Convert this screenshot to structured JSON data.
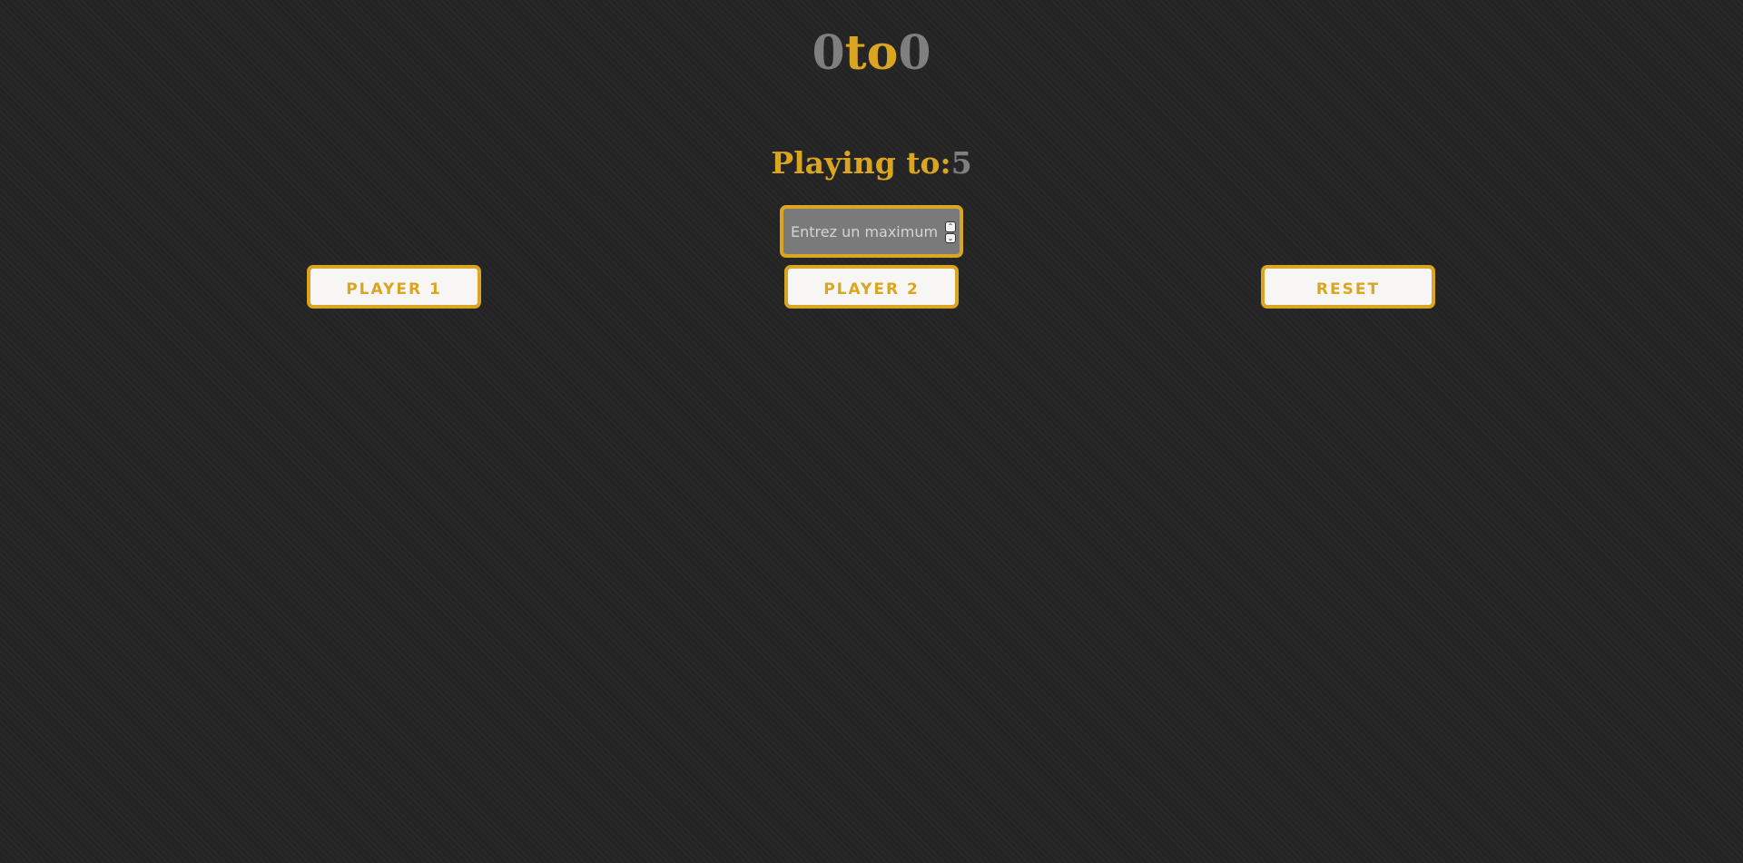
{
  "scoreboard": {
    "player1_score": "0",
    "separator": "to",
    "player2_score": "0"
  },
  "playing_to": {
    "label": "Playing to:",
    "max_score": "5"
  },
  "max_input": {
    "placeholder": "Entrez un maximum",
    "value": ""
  },
  "buttons": {
    "player1": "Player 1",
    "player2": "Player 2",
    "reset": "Reset"
  },
  "colors": {
    "accent": "#daa520",
    "score_gray": "#7f7f7f",
    "background": "#242424",
    "button_bg": "#f8f6f4"
  }
}
